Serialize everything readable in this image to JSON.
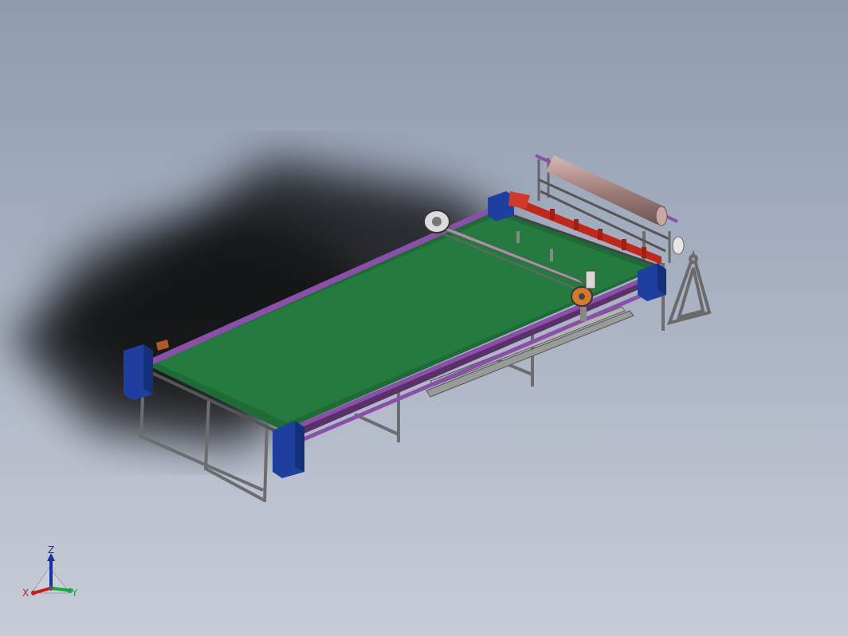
{
  "viewport": {
    "background_top": "#8e9bb0",
    "background_bottom": "#c8ccd8"
  },
  "model": {
    "colors": {
      "table_surface": "#257a3f",
      "rail": "#8a4fa8",
      "frame": "#7c7c7c",
      "end_block": "#1f3f9e",
      "roller": "#b08a88",
      "red_bar": "#c0281e",
      "gear": "#d47a2a"
    }
  },
  "triad": {
    "x_label": "X",
    "y_label": "Y",
    "z_label": "Z",
    "x_color": "#c81e1e",
    "y_color": "#1ea63c",
    "z_color": "#1c2fa8"
  }
}
